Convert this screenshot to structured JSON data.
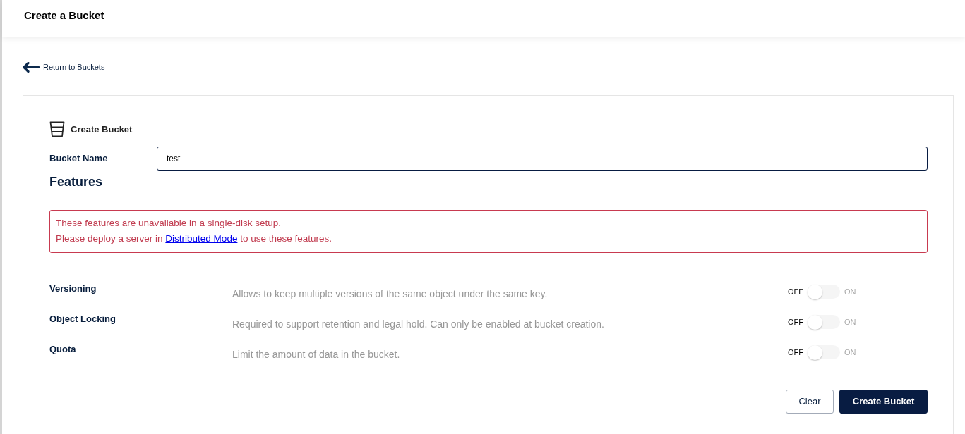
{
  "header": {
    "title": "Create a Bucket"
  },
  "back_link": {
    "label": "Return to Buckets"
  },
  "form": {
    "title": "Create Bucket",
    "bucket_name": {
      "label": "Bucket Name",
      "value": "test"
    },
    "features": {
      "heading": "Features",
      "alert": {
        "line_1": "These features are unavailable in a single-disk setup.",
        "line_2": {
          "before": "Please deploy a server in",
          "link": "Distributed Mode",
          "after": "to use these features."
        }
      },
      "items": [
        {
          "label": "Versioning",
          "description": "Allows to keep multiple versions of the same object under the same key.",
          "off_label": "OFF",
          "on_label": "ON",
          "on": false,
          "disabled": true
        },
        {
          "label": "Object Locking",
          "description": "Required to support retention and legal hold. Can only be enabled at bucket creation.",
          "off_label": "OFF",
          "on_label": "ON",
          "on": false,
          "disabled": true
        },
        {
          "label": "Quota",
          "description": "Limit the amount of data in the bucket.",
          "off_label": "OFF",
          "on_label": "ON",
          "on": false,
          "disabled": true
        }
      ]
    },
    "buttons": [
      {
        "label": "Clear",
        "kind": "secondary"
      },
      {
        "label": "Create Bucket",
        "kind": "primary"
      }
    ]
  }
}
